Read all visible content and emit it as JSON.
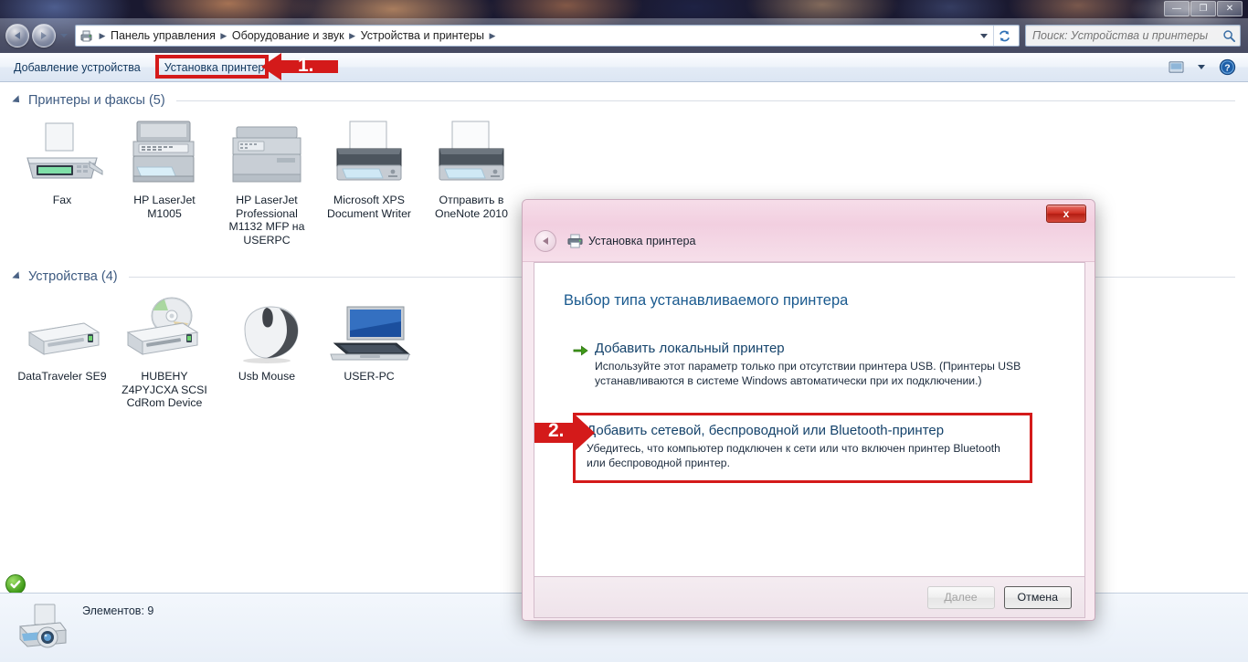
{
  "window": {
    "controls": [
      {
        "name": "minimize",
        "glyph": "—"
      },
      {
        "name": "restore",
        "glyph": "❐"
      },
      {
        "name": "close",
        "glyph": "✕"
      }
    ]
  },
  "address_bar": {
    "icon": "devices-printers-icon",
    "breadcrumbs": [
      "Панель управления",
      "Оборудование и звук",
      "Устройства и принтеры"
    ],
    "separator": "▶",
    "dropdown_icon": "chevron-down-icon",
    "refresh_icon": "refresh-icon"
  },
  "search": {
    "placeholder": "Поиск: Устройства и принтеры",
    "value": "",
    "icon": "search-icon"
  },
  "toolbar": {
    "add_device_label": "Добавление устройства",
    "install_printer_label": "Установка принтера",
    "view_icon": "view-pane-icon",
    "view_dropdown_icon": "chevron-down-icon",
    "help_icon": "help-icon"
  },
  "sections": [
    {
      "id": "printers",
      "title": "Принтеры и факсы (5)",
      "items": [
        {
          "label": "Fax",
          "icon": "fax-machine-icon",
          "default": false
        },
        {
          "label": "HP LaserJet M1005",
          "icon": "printer-mfp-icon",
          "default": true
        },
        {
          "label": "HP LaserJet Professional M1132 MFP на USERPC",
          "icon": "printer-network-icon",
          "default": false
        },
        {
          "label": "Microsoft XPS Document Writer",
          "icon": "printer-icon",
          "default": false
        },
        {
          "label": "Отправить в OneNote 2010",
          "icon": "printer-icon",
          "default": false
        }
      ]
    },
    {
      "id": "devices",
      "title": "Устройства (4)",
      "items": [
        {
          "label": "DataTraveler SE9",
          "icon": "usb-drive-icon",
          "default": false
        },
        {
          "label": "HUBEHY Z4PYJCXA SCSI CdRom Device",
          "icon": "cdrom-drive-icon",
          "default": false
        },
        {
          "label": "Usb Mouse",
          "icon": "mouse-icon",
          "default": false
        },
        {
          "label": "USER-PC",
          "icon": "laptop-icon",
          "default": false
        }
      ]
    }
  ],
  "status_bar": {
    "icon": "scanner-printer-icon",
    "text": "Элементов: 9"
  },
  "dialog": {
    "title": "Установка принтера",
    "title_icon": "printer-icon",
    "back_icon": "back-arrow-icon",
    "close_label": "x",
    "heading": "Выбор типа устанавливаемого принтера",
    "options": [
      {
        "id": "local",
        "icon": "green-arrow-icon",
        "title": "Добавить локальный принтер",
        "description": "Используйте этот параметр только при отсутствии принтера USB. (Принтеры USB устанавливаются в системе Windows автоматически при их подключении.)"
      },
      {
        "id": "network",
        "icon": "green-arrow-icon",
        "title": "Добавить сетевой, беспроводной или Bluetooth-принтер",
        "description": "Убедитесь, что компьютер подключен к сети или что включен принтер Bluetooth или беспроводной принтер."
      }
    ],
    "buttons": {
      "next": "Далее",
      "cancel": "Отмена"
    }
  },
  "annotations": [
    {
      "id": "step-1",
      "label": "1.",
      "target": "Установка принтера"
    },
    {
      "id": "step-2",
      "label": "2.",
      "target": "Добавить сетевой, беспроводной или Bluetooth-принтер"
    }
  ],
  "colors": {
    "annotation_red": "#d41a1a",
    "heading_blue": "#1a5a8f",
    "section_blue": "#3d5a80",
    "dialog_pink": "#f2cfe0"
  }
}
